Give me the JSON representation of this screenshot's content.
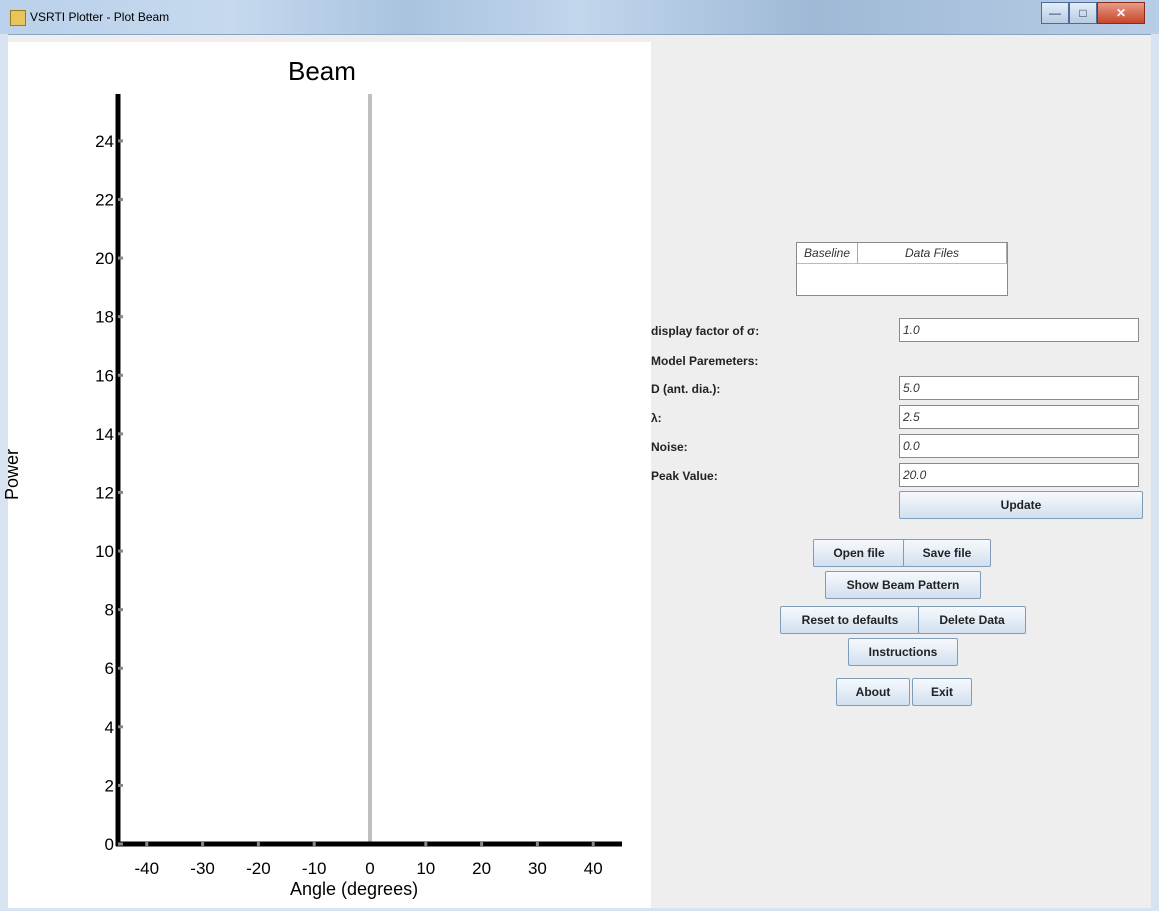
{
  "window": {
    "title": "VSRTI Plotter - Plot Beam",
    "minimize_icon": "minimize-icon",
    "maximize_icon": "maximize-icon",
    "close_icon": "close-icon"
  },
  "chart_data": {
    "type": "line",
    "title": "Beam",
    "xlabel": "Angle (degrees)",
    "ylabel": "Power",
    "xlim": [
      -45,
      45
    ],
    "ylim": [
      0,
      25
    ],
    "x_ticks": [
      -40,
      -30,
      -20,
      -10,
      0,
      10,
      20,
      30,
      40
    ],
    "y_ticks": [
      0,
      2,
      4,
      6,
      8,
      10,
      12,
      14,
      16,
      18,
      20,
      22,
      24
    ],
    "x_tick_labels": [
      "-40",
      "-30",
      "-20",
      "-10",
      "0",
      "10",
      "20",
      "30",
      "40"
    ],
    "y_tick_labels": [
      "0",
      "2",
      "4",
      "6",
      "8",
      "10",
      "12",
      "14",
      "16",
      "18",
      "20",
      "22",
      "24"
    ],
    "center_line_color": "#c0c0c0",
    "series": []
  },
  "table": {
    "columns": [
      "Baseline",
      "Data Files"
    ],
    "rows": []
  },
  "params": {
    "display_factor_label": "display factor of σ:",
    "display_factor_value": "1.0",
    "model_label": "Model Paremeters:",
    "d_label": "D (ant. dia.):",
    "d_value": "5.0",
    "lambda_label": "λ:",
    "lambda_value": "2.5",
    "noise_label": "Noise:",
    "noise_value": "0.0",
    "peak_label": "Peak Value:",
    "peak_value": "20.0"
  },
  "buttons": {
    "update": "Update",
    "open_file": "Open file",
    "save_file": "Save file",
    "show_beam": "Show Beam Pattern",
    "reset": "Reset to defaults",
    "delete": "Delete Data",
    "instructions": "Instructions",
    "about": "About",
    "exit": "Exit"
  }
}
